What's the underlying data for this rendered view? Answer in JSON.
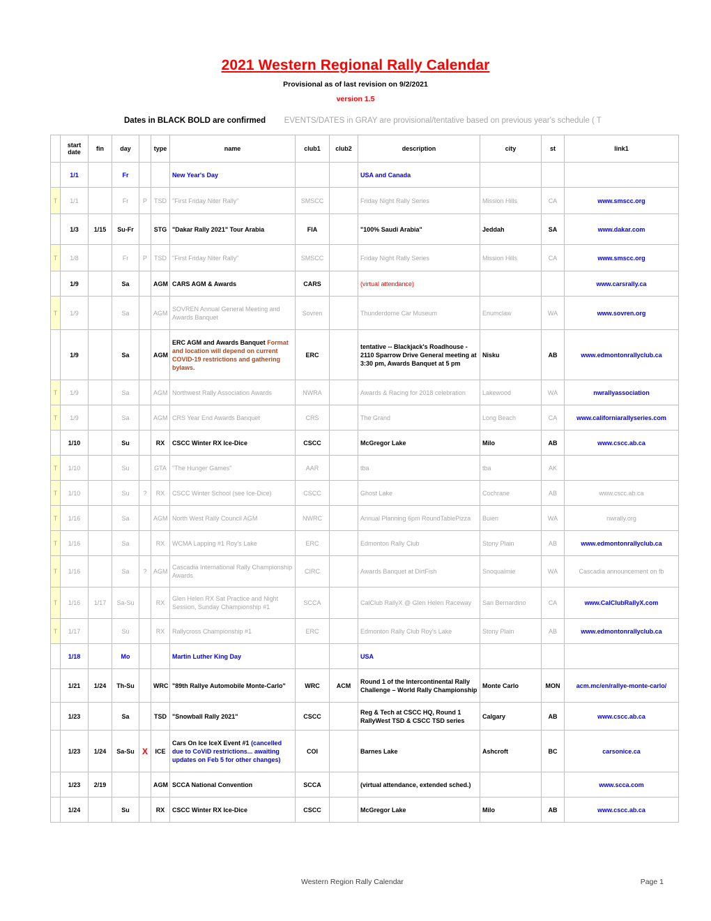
{
  "document": {
    "title": "2021 Western Regional Rally Calendar",
    "subtitle": "Provisional as of last revision on 9/2/2021",
    "version": "version 1.5",
    "legend_bold": "Dates in BLACK BOLD are confirmed",
    "legend_gray": "EVENTS/DATES in GRAY are provisional/tentative based on previous year's schedule ( T"
  },
  "colors": {
    "title_red": "#FF0000",
    "confirmed_black": "#000000",
    "tentative_gray": "#A6A6A6",
    "holiday_blue": "#0000FF",
    "note_orange": "#B5451A",
    "flag_highlight": "#FFFFCC"
  },
  "table": {
    "columns": [
      {
        "key": "flag",
        "label": ""
      },
      {
        "key": "start",
        "label": "start date"
      },
      {
        "key": "fin",
        "label": "fin"
      },
      {
        "key": "day",
        "label": "day"
      },
      {
        "key": "mark",
        "label": ""
      },
      {
        "key": "type",
        "label": "type"
      },
      {
        "key": "name",
        "label": "name"
      },
      {
        "key": "club1",
        "label": "club1"
      },
      {
        "key": "club2",
        "label": "club2"
      },
      {
        "key": "desc",
        "label": "description"
      },
      {
        "key": "city",
        "label": "city"
      },
      {
        "key": "st",
        "label": "st"
      },
      {
        "key": "link",
        "label": "link1"
      }
    ],
    "rows": [
      {
        "state": "holiday",
        "flag": "",
        "start": "1/1",
        "fin": "",
        "day": "Fr",
        "mark": "",
        "type": "",
        "name": "New Year's Day",
        "club1": "",
        "club2": "",
        "desc": "USA and Canada",
        "city": "",
        "st": "",
        "link": ""
      },
      {
        "state": "tentative",
        "flag": "T",
        "start": "1/1",
        "fin": "",
        "day": "Fr",
        "mark": "P",
        "type": "TSD",
        "name": "\"First Friday Niter Rally\"",
        "club1": "SMSCC",
        "club2": "",
        "desc": "Friday Night Rally Series",
        "city": "Mission Hills",
        "st": "CA",
        "link": "www.smscc.org",
        "link_blue": true
      },
      {
        "state": "confirmed",
        "flag": "",
        "start": "1/3",
        "fin": "1/15",
        "day": "Su-Fr",
        "mark": "",
        "type": "STG",
        "name": "\"Dakar Rally 2021\"   Tour Arabia",
        "club1": "FIA",
        "club2": "",
        "desc": "\"100% Saudi Arabia\"",
        "city": "Jeddah",
        "st": "SA",
        "link": "www.dakar.com"
      },
      {
        "state": "tentative",
        "flag": "T",
        "start": "1/8",
        "fin": "",
        "day": "Fr",
        "mark": "P",
        "type": "TSD",
        "name": "\"First Friday Niter Rally\"",
        "club1": "SMSCC",
        "club2": "",
        "desc": "Friday Night Rally Series",
        "city": "Mission Hills",
        "st": "CA",
        "link": "www.smscc.org",
        "link_blue": true
      },
      {
        "state": "confirmed",
        "flag": "",
        "start": "1/9",
        "fin": "",
        "day": "Sa",
        "mark": "",
        "type": "AGM",
        "name": "CARS   AGM & Awards",
        "club1": "CARS",
        "club2": "",
        "desc": "(virtual attendance)",
        "desc_style": "red",
        "city": "",
        "st": "",
        "link": "www.carsrally.ca"
      },
      {
        "state": "tentative",
        "flag": "T",
        "start": "1/9",
        "fin": "",
        "day": "Sa",
        "mark": "",
        "type": "AGM",
        "name": "SOVREN Annual General Meeting and Awards Banquet",
        "club1": "Sovren",
        "club2": "",
        "desc": "Thunderdome Car Museum",
        "city": "Enumclaw",
        "st": "WA",
        "link": "www.sovren.org",
        "link_blue": true
      },
      {
        "state": "confirmed",
        "flag": "",
        "start": "1/9",
        "fin": "",
        "day": "Sa",
        "mark": "",
        "type": "AGM",
        "name": "ERC   AGM and Awards Banquet",
        "name_note": "Format and location will depend on current COVID-19 restrictions and gathering bylaws.",
        "club1": "ERC",
        "club2": "",
        "desc": "tentative -- Blackjack's Roadhouse - 2110 Sparrow Drive  General meeting at 3:30 pm, Awards Banquet at 5 pm",
        "city": "Nisku",
        "st": "AB",
        "link": "www.edmontonrallyclub.ca"
      },
      {
        "state": "tentative",
        "flag": "T",
        "start": "1/9",
        "fin": "",
        "day": "Sa",
        "mark": "",
        "type": "AGM",
        "name": "Northwest Rally Association Awards",
        "club1": "NWRA",
        "club2": "",
        "desc": "Awards & Racing for 2018 celebration",
        "city": "Lakewood",
        "st": "WA",
        "link": "nwrallyassociation",
        "link_blue": true
      },
      {
        "state": "tentative",
        "flag": "T",
        "start": "1/9",
        "fin": "",
        "day": "Sa",
        "mark": "",
        "type": "AGM",
        "name": "CRS Year End Awards Banquet",
        "club1": "CRS",
        "club2": "",
        "desc": "The Grand",
        "city": "Long Beach",
        "st": "CA",
        "link": "www.californiarallyseries.com",
        "link_blue": true
      },
      {
        "state": "confirmed",
        "flag": "",
        "start": "1/10",
        "fin": "",
        "day": "Su",
        "mark": "",
        "type": "RX",
        "name": "CSCC Winter RX Ice-Dice",
        "club1": "CSCC",
        "club2": "",
        "desc": "McGregor Lake",
        "city": "Milo",
        "st": "AB",
        "link": "www.cscc.ab.ca"
      },
      {
        "state": "tentative",
        "flag": "T",
        "start": "1/10",
        "fin": "",
        "day": "Su",
        "mark": "",
        "type": "GTA",
        "name": "\"The Hunger Games\"",
        "club1": "AAR",
        "club2": "",
        "desc": "tba",
        "city": "tba",
        "st": "AK",
        "link": ""
      },
      {
        "state": "tentative",
        "flag": "T",
        "start": "1/10",
        "fin": "",
        "day": "Su",
        "mark": "?",
        "type": "RX",
        "name": "CSCC Winter School  (see Ice-Dice)",
        "club1": "CSCC",
        "club2": "",
        "desc": "Ghost Lake",
        "city": "Cochrane",
        "st": "AB",
        "link": "www.cscc.ab.ca"
      },
      {
        "state": "tentative",
        "flag": "T",
        "start": "1/16",
        "fin": "",
        "day": "Sa",
        "mark": "",
        "type": "AGM",
        "name": "North West Rally Council AGM",
        "club1": "NWRC",
        "club2": "",
        "desc": "Annual Planning 6pm RoundTablePizza",
        "city": "Buien",
        "st": "WA",
        "link": "nwrally.org"
      },
      {
        "state": "tentative",
        "flag": "T",
        "start": "1/16",
        "fin": "",
        "day": "Sa",
        "mark": "",
        "type": "RX",
        "name": "WCMA Lapping #1  Roy's Lake",
        "club1": "ERC",
        "club2": "",
        "desc": "Edmonton Rally Club",
        "city": "Stony Plain",
        "st": "AB",
        "link": "www.edmontonrallyclub.ca",
        "link_blue": true
      },
      {
        "state": "tentative",
        "flag": "T",
        "start": "1/16",
        "fin": "",
        "day": "Sa",
        "mark": "?",
        "type": "AGM",
        "name": "Cascadia International Rally Championship Awards",
        "club1": "CIRC",
        "club2": "",
        "desc": "Awards Banquet at DirtFish",
        "city": "Snoqualmie",
        "st": "WA",
        "link": "Cascadia announcement on fb"
      },
      {
        "state": "tentative",
        "flag": "T",
        "start": "1/16",
        "fin": "1/17",
        "day": "Sa-Su",
        "mark": "",
        "type": "RX",
        "name": "Glen Helen RX  Sat Practice and Night Session, Sunday Championship #1",
        "club1": "SCCA",
        "club2": "",
        "desc": "CalClub RallyX @ Glen Helen Raceway",
        "city": "San Bernardino",
        "st": "CA",
        "link": "www.CalClubRallyX.com",
        "link_blue": true
      },
      {
        "state": "tentative",
        "flag": "T",
        "start": "1/17",
        "fin": "",
        "day": "Su",
        "mark": "",
        "type": "RX",
        "name": "Rallycross Championship  #1",
        "club1": "ERC",
        "club2": "",
        "desc": "Edmonton Rally Club   Roy's Lake",
        "city": "Stony Plain",
        "st": "AB",
        "link": "www.edmontonrallyclub.ca",
        "link_blue": true
      },
      {
        "state": "holiday",
        "flag": "",
        "start": "1/18",
        "fin": "",
        "day": "Mo",
        "mark": "",
        "type": "",
        "name": "Martin Luther King Day",
        "club1": "",
        "club2": "",
        "desc": "USA",
        "city": "",
        "st": "",
        "link": ""
      },
      {
        "state": "confirmed",
        "flag": "",
        "start": "1/21",
        "fin": "1/24",
        "day": "Th-Su",
        "mark": "",
        "type": "WRC",
        "name": "\"89th Rallye Automobile Monte-Carlo\"",
        "club1": "WRC",
        "club2": "ACM",
        "desc": "Round 1 of the Intercontinental Rally Challenge – World Rally Championship",
        "city": "Monte Carlo",
        "st": "MON",
        "link": "acm.mc/en/rallye-monte-carlo/"
      },
      {
        "state": "confirmed",
        "flag": "",
        "start": "1/23",
        "fin": "",
        "day": "Sa",
        "mark": "",
        "type": "TSD",
        "name": "\"Snowball Rally 2021\"",
        "club1": "CSCC",
        "club2": "",
        "desc": "Reg & Tech at CSCC HQ, Round 1 RallyWest TSD & CSCC TSD series",
        "city": "Calgary",
        "st": "AB",
        "link": "www.cscc.ab.ca"
      },
      {
        "state": "confirmed",
        "flag": "",
        "start": "1/23",
        "fin": "1/24",
        "day": "Sa-Su",
        "mark": "X",
        "mark_style": "x",
        "type": "ICE",
        "name": "Cars On Ice  IceX Event #1",
        "name_note_blue": "(cancelled due to CoViD restrictions... awaiting updates on Feb 5 for other changes)",
        "club1": "COI",
        "club2": "",
        "desc": "Barnes Lake",
        "city": "Ashcroft",
        "st": "BC",
        "link": "carsonice.ca"
      },
      {
        "state": "confirmed",
        "flag": "",
        "start": "1/23",
        "fin": "2/19",
        "day": "",
        "mark": "",
        "type": "AGM",
        "name": "SCCA National Convention",
        "club1": "SCCA",
        "club2": "",
        "desc": "(virtual attendance, extended sched.)",
        "city": "",
        "st": "",
        "link": "www.scca.com"
      },
      {
        "state": "confirmed",
        "flag": "",
        "start": "1/24",
        "fin": "",
        "day": "Su",
        "mark": "",
        "type": "RX",
        "name": "CSCC Winter RX Ice-Dice",
        "club1": "CSCC",
        "club2": "",
        "desc": "McGregor Lake",
        "city": "Milo",
        "st": "AB",
        "link": "www.cscc.ab.ca"
      }
    ]
  },
  "footer": {
    "left": "Western Region Rally Calendar",
    "right": "Page 1"
  }
}
